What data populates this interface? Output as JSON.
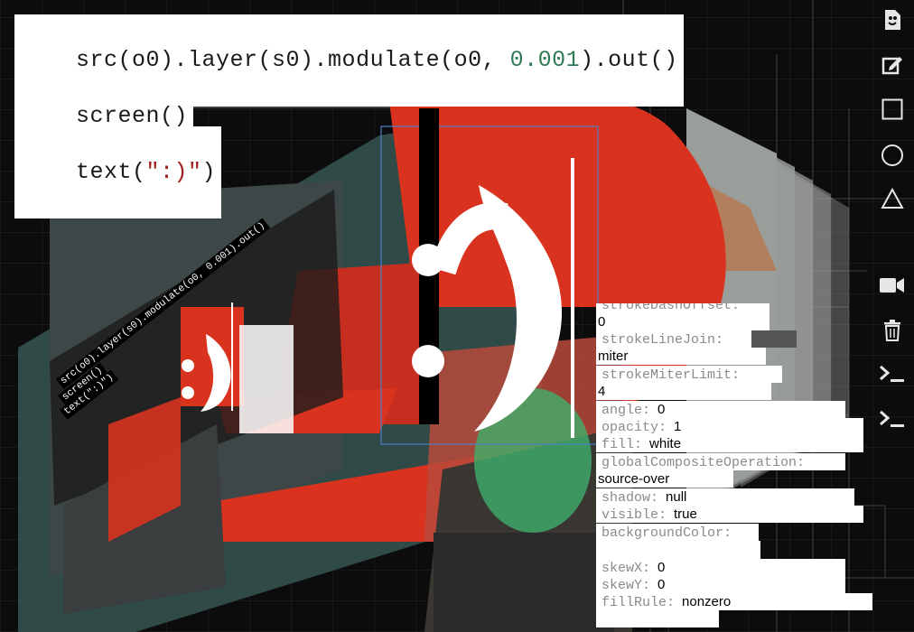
{
  "code": {
    "line1": {
      "pre": "src(o0).layer(s0).modulate(o0, ",
      "num": "0.001",
      "post": ").out()"
    },
    "line2": "screen()",
    "line3": {
      "pre": "text(",
      "str": "\":)\"",
      "post": ")"
    }
  },
  "overlay_text": ":)",
  "nested_code": [
    "src(o0).layer(s0).modulate(o0, 0.001).out()",
    "screen()",
    "text(\":)\")"
  ],
  "toolbar": [
    {
      "icon": "new-file-icon",
      "glyph": "▣"
    },
    {
      "icon": "edit-icon",
      "glyph": "✎"
    },
    {
      "icon": "square-icon",
      "glyph": "□"
    },
    {
      "icon": "circle-icon",
      "glyph": "○"
    },
    {
      "icon": "triangle-icon",
      "glyph": "△"
    },
    {
      "icon": "video-camera-icon",
      "glyph": "■"
    },
    {
      "icon": "trash-icon",
      "glyph": "🗑"
    },
    {
      "icon": "terminal-icon",
      "glyph": ">_"
    },
    {
      "icon": "terminal-icon-2",
      "glyph": ">_"
    }
  ],
  "props": {
    "strokeDashOffset_label": "strokeDashOffset:",
    "strokeDashOffset_value": "0",
    "strokeLineJoin_label": "strokeLineJoin:",
    "strokeLineJoin_value": "miter",
    "strokeMiterLimit_label": "strokeMiterLimit:",
    "strokeMiterLimit_value": "4",
    "angle_label": "angle:",
    "angle_value": "0",
    "opacity_label": "opacity:",
    "opacity_value": "1",
    "fill_label": "fill:",
    "fill_value": "white",
    "gco_label": "globalCompositeOperation:",
    "gco_value": "source-over",
    "shadow_label": "shadow:",
    "shadow_value": "null",
    "visible_label": "visible:",
    "visible_value": "true",
    "backgroundColor_label": "backgroundColor:",
    "skewX_label": "skewX:",
    "skewX_value": "0",
    "skewY_label": "skewY:",
    "skewY_value": "0",
    "fillRule_label": "fillRule:",
    "fillRule_value": "nonzero"
  },
  "colors": {
    "accent_red": "#d9331f",
    "code_number": "#2f7a54",
    "code_string": "#a01f1f",
    "teal": "#2f4a47"
  }
}
